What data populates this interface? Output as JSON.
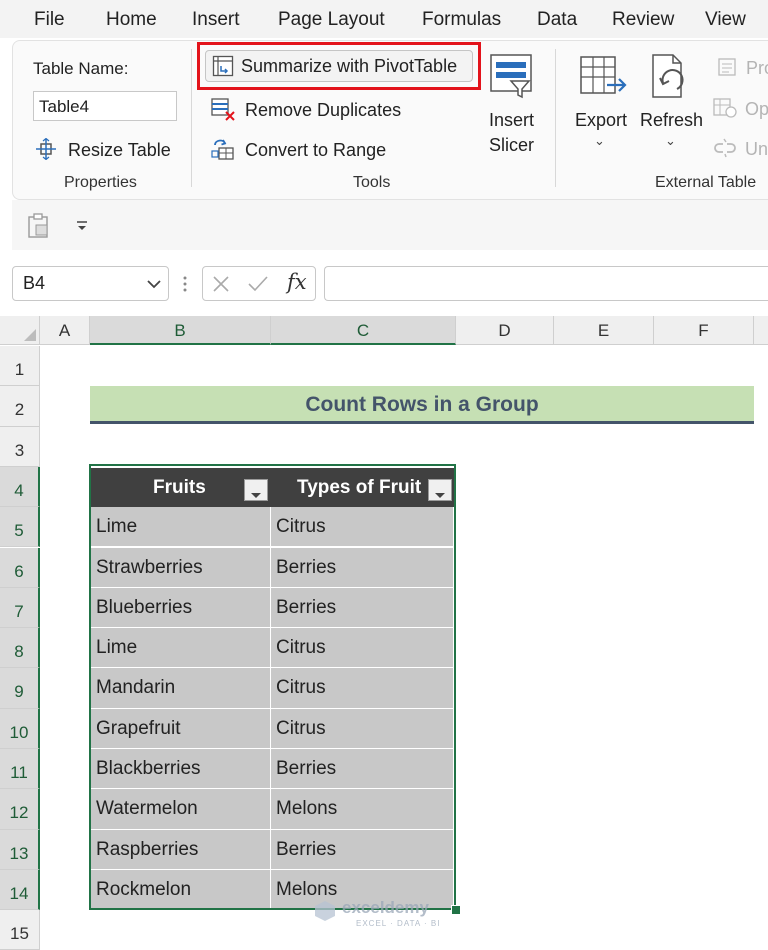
{
  "menu": {
    "items": [
      "File",
      "Home",
      "Insert",
      "Page Layout",
      "Formulas",
      "Data",
      "Review",
      "View"
    ]
  },
  "ribbon": {
    "properties": {
      "table_name_label": "Table Name:",
      "table_name_value": "Table4",
      "resize_label": "Resize Table",
      "group_label": "Properties"
    },
    "tools": {
      "summarize_label": "Summarize with PivotTable",
      "remove_dup_label": "Remove Duplicates",
      "convert_label": "Convert to Range",
      "group_label": "Tools"
    },
    "insert_slicer": {
      "line1": "Insert",
      "line2": "Slicer"
    },
    "external": {
      "export_label": "Export",
      "refresh_label": "Refresh",
      "properties_partial": "Pro",
      "open_partial": "Op",
      "unlink_partial": "Un",
      "group_label": "External Table"
    }
  },
  "formula_bar": {
    "name_box": "B4",
    "fx": "fx",
    "formula": ""
  },
  "grid": {
    "columns": [
      "A",
      "B",
      "C",
      "D",
      "E",
      "F"
    ],
    "rows": [
      "1",
      "2",
      "3",
      "4",
      "5",
      "6",
      "7",
      "8",
      "9",
      "10",
      "11",
      "12",
      "13",
      "14",
      "15"
    ],
    "title": "Count Rows in a Group",
    "headers": [
      "Fruits",
      "Types of Fruit"
    ],
    "data": [
      [
        "Lime",
        "Citrus"
      ],
      [
        "Strawberries",
        "Berries"
      ],
      [
        "Blueberries",
        "Berries"
      ],
      [
        "Lime",
        "Citrus"
      ],
      [
        "Mandarin",
        "Citrus"
      ],
      [
        "Grapefruit",
        "Citrus"
      ],
      [
        "Blackberries",
        "Berries"
      ],
      [
        "Watermelon",
        "Melons"
      ],
      [
        "Raspberries",
        "Berries"
      ],
      [
        "Rockmelon",
        "Melons"
      ]
    ]
  },
  "watermark": {
    "brand": "exceldemy",
    "tagline": "EXCEL · DATA · BI"
  },
  "colors": {
    "accent_green": "#217346",
    "title_fill": "#c6e0b4",
    "header_fill": "#404040",
    "cell_fill": "#c8c8c8",
    "highlight_red": "#e3131b"
  }
}
